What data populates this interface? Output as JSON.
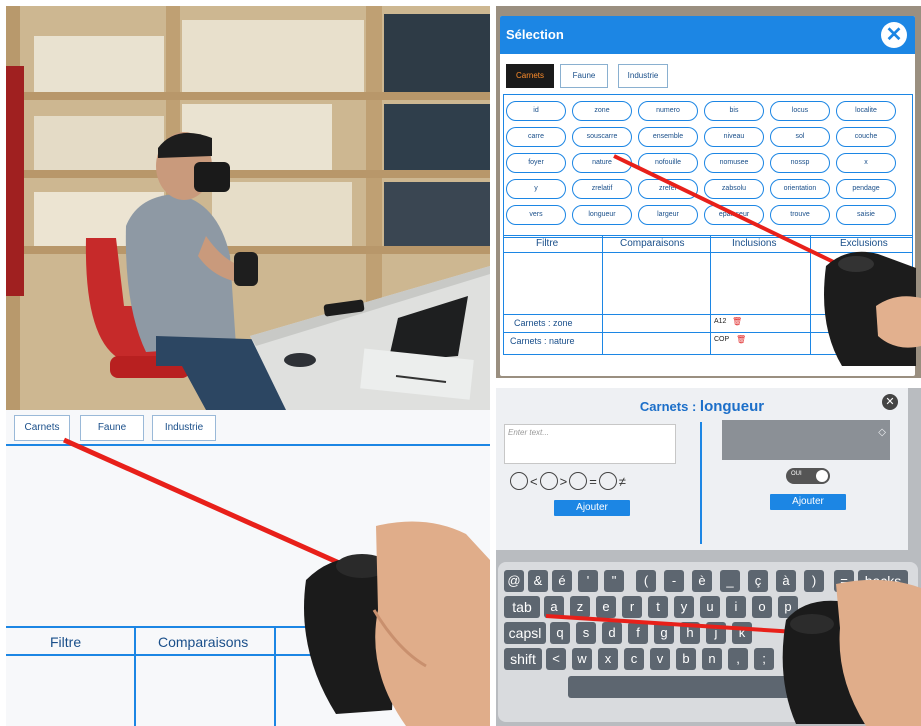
{
  "selection": {
    "title": "Sélection",
    "tabs": [
      "Carnets",
      "Faune",
      "Industrie"
    ],
    "active_tab": "Carnets",
    "chips": [
      [
        "id",
        "zone",
        "numero",
        "bis",
        "locus",
        "localite"
      ],
      [
        "carre",
        "souscarre",
        "ensemble",
        "niveau",
        "sol",
        "couche"
      ],
      [
        "foyer",
        "nature",
        "nofouille",
        "nomusee",
        "nossp",
        "x"
      ],
      [
        "y",
        "zrelatif",
        "zrefer",
        "zabsolu",
        "orientation",
        "pendage"
      ],
      [
        "vers",
        "longueur",
        "largeur",
        "epaisseur",
        "trouve",
        "saisie"
      ]
    ],
    "columns": [
      "Filtre",
      "Comparaisons",
      "Inclusions",
      "Exclusions"
    ],
    "rows": [
      {
        "filter": "Carnets : zone",
        "inclusion": "A12"
      },
      {
        "filter": "Carnets : nature",
        "inclusion": "COP"
      }
    ]
  },
  "closeup": {
    "tabs": [
      "Carnets",
      "Faune",
      "Industrie"
    ],
    "columns": [
      "Filtre",
      "Comparaisons",
      "Inclusions"
    ]
  },
  "keyboard": {
    "title_prefix": "Carnets :",
    "title_field": "longueur",
    "text_placeholder": "Enter text...",
    "operators": [
      "<",
      ">",
      "=",
      "≠"
    ],
    "add_left_label": "Ajouter",
    "add_right_label": "Ajouter",
    "toggle_label": "OUI",
    "toggle_on": true,
    "rows": [
      [
        "@",
        "&",
        "é",
        "'",
        "\"",
        "(",
        "-",
        "è",
        "_",
        "ç",
        "à",
        ")",
        "=",
        "backs"
      ],
      [
        "tab",
        "a",
        "z",
        "e",
        "r",
        "t",
        "y",
        "u",
        "i",
        "o",
        "p"
      ],
      [
        "capsl",
        "q",
        "s",
        "d",
        "f",
        "g",
        "h",
        "j",
        "k"
      ],
      [
        "shift",
        "<",
        "w",
        "x",
        "c",
        "v",
        "b",
        "n",
        ",",
        ";"
      ]
    ]
  },
  "colors": {
    "accent": "#1c86e4",
    "laser": "#e8201a",
    "active_tab_text": "#ff8d2a",
    "delete_icon": "#e02a2a"
  }
}
